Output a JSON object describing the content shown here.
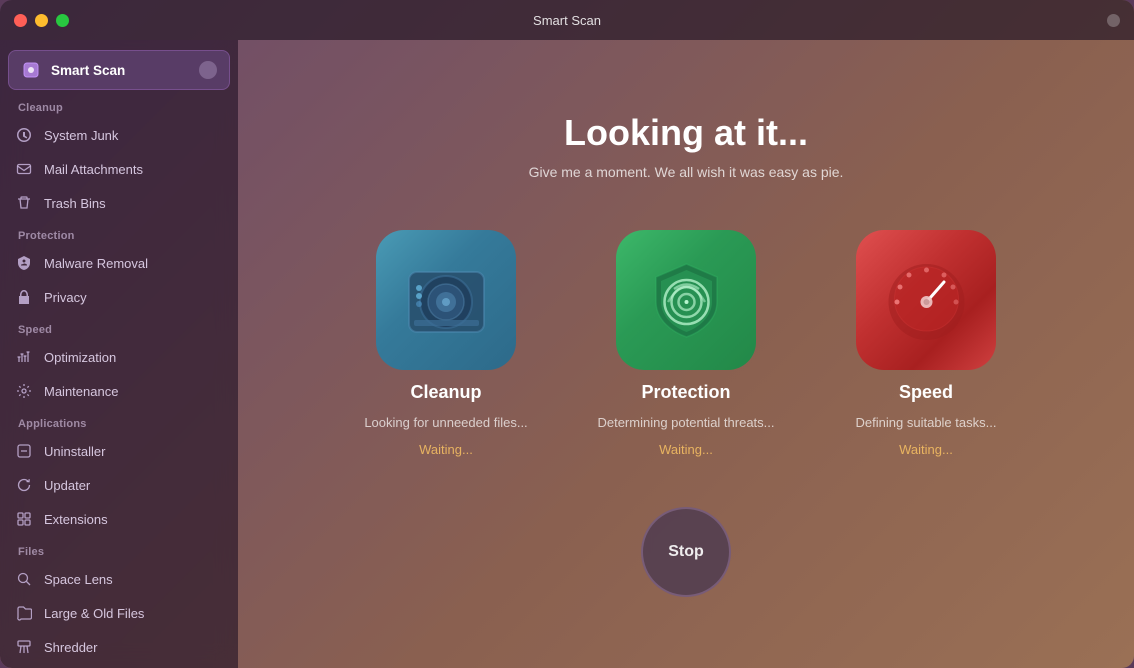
{
  "titleBar": {
    "title": "Smart Scan",
    "controls": {
      "close": "close",
      "minimize": "minimize",
      "maximize": "maximize"
    }
  },
  "sidebar": {
    "smartScan": {
      "label": "Smart Scan"
    },
    "sections": [
      {
        "label": "Cleanup",
        "items": [
          {
            "id": "system-junk",
            "label": "System Junk",
            "icon": "⚙"
          },
          {
            "id": "mail-attachments",
            "label": "Mail Attachments",
            "icon": "✉"
          },
          {
            "id": "trash-bins",
            "label": "Trash Bins",
            "icon": "🗑"
          }
        ]
      },
      {
        "label": "Protection",
        "items": [
          {
            "id": "malware-removal",
            "label": "Malware Removal",
            "icon": "⚡"
          },
          {
            "id": "privacy",
            "label": "Privacy",
            "icon": "✋"
          }
        ]
      },
      {
        "label": "Speed",
        "items": [
          {
            "id": "optimization",
            "label": "Optimization",
            "icon": "⚡"
          },
          {
            "id": "maintenance",
            "label": "Maintenance",
            "icon": "🔧"
          }
        ]
      },
      {
        "label": "Applications",
        "items": [
          {
            "id": "uninstaller",
            "label": "Uninstaller",
            "icon": "⊟"
          },
          {
            "id": "updater",
            "label": "Updater",
            "icon": "↻"
          },
          {
            "id": "extensions",
            "label": "Extensions",
            "icon": "⊞"
          }
        ]
      },
      {
        "label": "Files",
        "items": [
          {
            "id": "space-lens",
            "label": "Space Lens",
            "icon": "◎"
          },
          {
            "id": "large-old-files",
            "label": "Large & Old Files",
            "icon": "📁"
          },
          {
            "id": "shredder",
            "label": "Shredder",
            "icon": "⊠"
          }
        ]
      }
    ]
  },
  "main": {
    "heading": "Looking at it...",
    "subtext": "Give me a moment. We all wish it was easy as pie.",
    "cards": [
      {
        "id": "cleanup",
        "title": "Cleanup",
        "status": "Looking for unneeded files...",
        "waiting": "Waiting..."
      },
      {
        "id": "protection",
        "title": "Protection",
        "status": "Determining potential threats...",
        "waiting": "Waiting..."
      },
      {
        "id": "speed",
        "title": "Speed",
        "status": "Defining suitable tasks...",
        "waiting": "Waiting..."
      }
    ],
    "stopButton": "Stop"
  }
}
